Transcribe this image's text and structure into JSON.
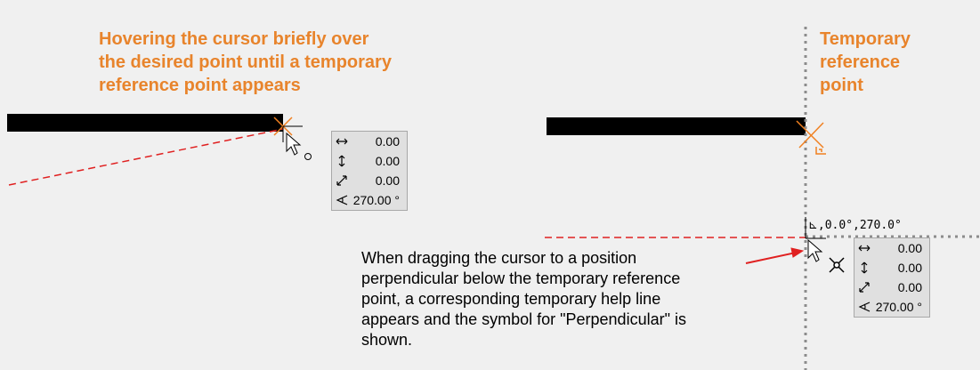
{
  "left_caption": {
    "line1": "Hovering the cursor briefly over",
    "line2": "the desired point until a temporary",
    "line3": "reference point appears"
  },
  "right_caption": {
    "line1": "Temporary",
    "line2": "reference",
    "line3": "point"
  },
  "panel_left": {
    "rows": [
      {
        "icon": "horizontal-arrow-icon",
        "value": "0.00"
      },
      {
        "icon": "vertical-arrow-icon",
        "value": "0.00"
      },
      {
        "icon": "diagonal-arrow-icon",
        "value": "0.00"
      },
      {
        "icon": "angle-icon",
        "value": "270.00 °"
      }
    ]
  },
  "panel_right": {
    "rows": [
      {
        "icon": "horizontal-arrow-icon",
        "value": "0.00"
      },
      {
        "icon": "vertical-arrow-icon",
        "value": "0.00"
      },
      {
        "icon": "diagonal-arrow-icon",
        "value": "0.00"
      },
      {
        "icon": "angle-icon",
        "value": "270.00 °"
      }
    ]
  },
  "coord_label": "⊾,0.0°,270.0°",
  "note": {
    "line1": "When dragging the cursor to a position",
    "line2": "perpendicular below the temporary reference",
    "line3": "point, a corresponding temporary help line",
    "line4": "appears and the symbol for \"Perpendicular\" is",
    "line5": "shown."
  },
  "colors": {
    "caption": "#e8842c",
    "help_line": "#e02020",
    "snap_marker": "#f08020",
    "guide_dots": "#8c8c8c"
  }
}
